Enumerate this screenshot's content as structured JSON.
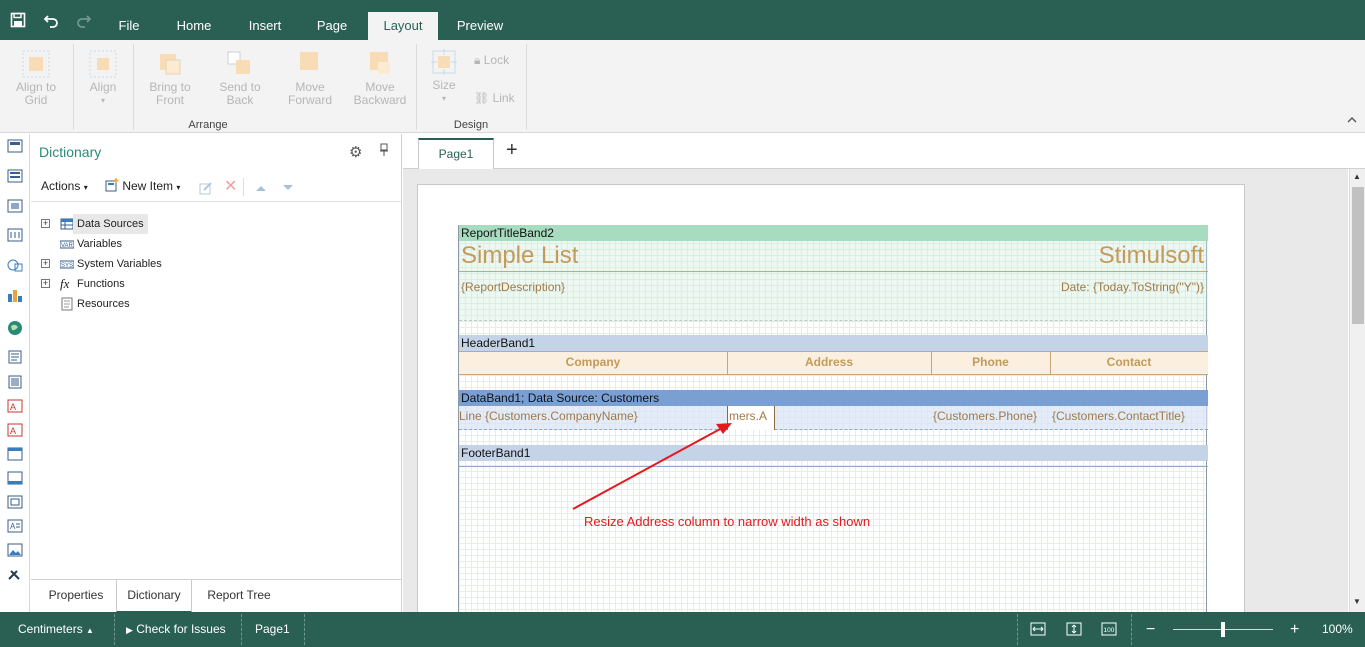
{
  "app": {
    "menu_tabs": [
      "File",
      "Home",
      "Insert",
      "Page",
      "Layout",
      "Preview"
    ],
    "active_tab": "Layout"
  },
  "ribbon": {
    "buttons": [
      {
        "label1": "Align to",
        "label2": "Grid",
        "icon": "align-to-grid-icon"
      },
      {
        "label1": "Align",
        "label2": "",
        "icon": "align-icon"
      },
      {
        "label1": "Bring to",
        "label2": "Front",
        "icon": "bring-to-front-icon"
      },
      {
        "label1": "Send to",
        "label2": "Back",
        "icon": "send-to-back-icon"
      },
      {
        "label1": "Move",
        "label2": "Forward",
        "icon": "move-forward-icon"
      },
      {
        "label1": "Move",
        "label2": "Backward",
        "icon": "move-backward-icon"
      },
      {
        "label1": "Size",
        "label2": "",
        "icon": "size-icon"
      }
    ],
    "lock_label": "Lock",
    "link_label": "Link",
    "groups": {
      "arrange": "Arrange",
      "design": "Design"
    }
  },
  "dictionary": {
    "title": "Dictionary",
    "toolbar": {
      "actions": "Actions",
      "new_item": "New Item"
    },
    "tree": [
      {
        "label": "Data Sources",
        "expandable": true,
        "icon": "data-sources-icon"
      },
      {
        "label": "Variables",
        "expandable": false,
        "icon": "variables-icon"
      },
      {
        "label": "System Variables",
        "expandable": true,
        "icon": "system-variables-icon"
      },
      {
        "label": "Functions",
        "expandable": true,
        "icon": "functions-icon"
      },
      {
        "label": "Resources",
        "expandable": false,
        "icon": "resources-icon"
      }
    ],
    "tabs": [
      "Properties",
      "Dictionary",
      "Report Tree"
    ],
    "active_tab": "Dictionary"
  },
  "pages": {
    "tabs": [
      "Page1"
    ],
    "add_label": "+"
  },
  "report": {
    "title_band": "ReportTitleBand2",
    "title_text": "Simple List",
    "brand_text": "Stimulsoft",
    "description": "{ReportDescription}",
    "date_expr": "Date: {Today.ToString(\"Y\")}",
    "header_band": "HeaderBand1",
    "headers": [
      "Company",
      "Address",
      "Phone",
      "Contact"
    ],
    "data_band": "DataBand1; Data Source: Customers",
    "data_line": "Line",
    "data_company": "{Customers.CompanyName}",
    "data_address": "mers.A",
    "data_phone": "{Customers.Phone}",
    "data_contact": "{Customers.ContactTitle}",
    "footer_band": "FooterBand1"
  },
  "annotation": "Resize Address column to narrow width as shown",
  "statusbar": {
    "units": "Centimeters",
    "check": "Check for Issues",
    "page": "Page1",
    "zoom": "100%",
    "zoom_level": 0.5
  },
  "colors": {
    "brand": "#2a6054",
    "title_band": "#a8dcc0",
    "header_band": "#c5d3e8",
    "data_band": "#7a9fd2",
    "accent_text": "#c49a5a",
    "annotation": "#e3191f"
  }
}
